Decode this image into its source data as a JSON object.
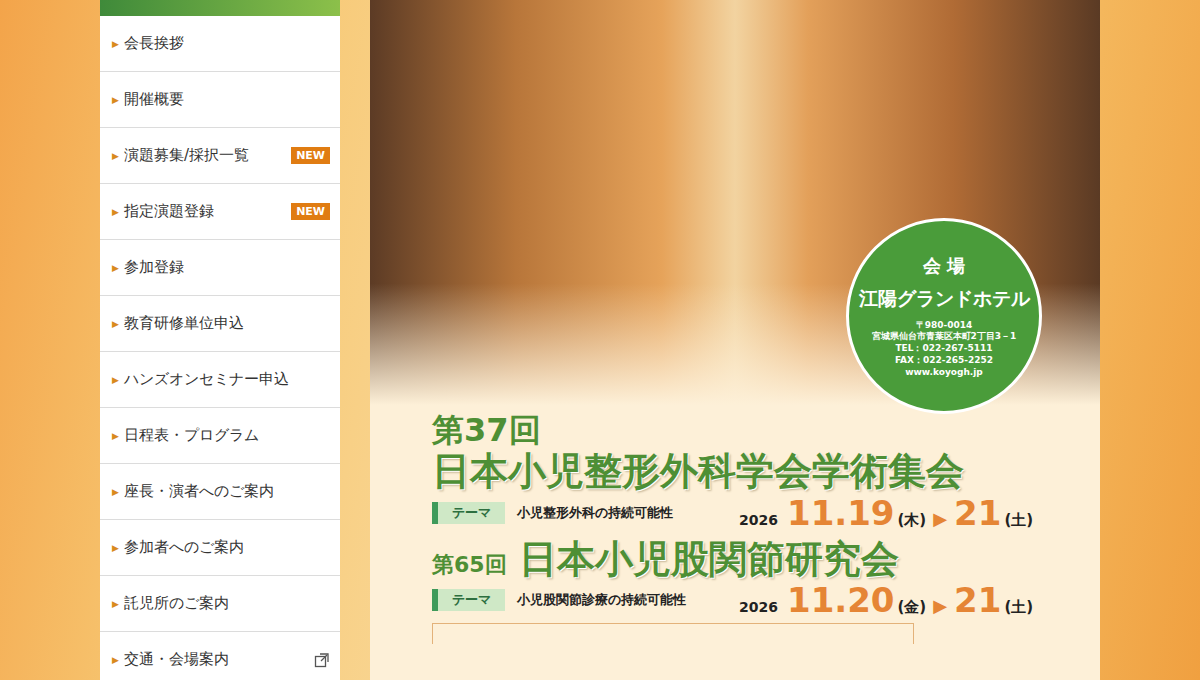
{
  "sidebar": {
    "bullet": "▶",
    "items": [
      {
        "label": "会長挨拶",
        "badge": "",
        "external": false
      },
      {
        "label": "開催概要",
        "badge": "",
        "external": false
      },
      {
        "label": "演題募集/採択一覧",
        "badge": "NEW",
        "external": false
      },
      {
        "label": "指定演題登録",
        "badge": "NEW",
        "external": false
      },
      {
        "label": "参加登録",
        "badge": "",
        "external": false
      },
      {
        "label": "教育研修単位申込",
        "badge": "",
        "external": false
      },
      {
        "label": "ハンズオンセミナー申込",
        "badge": "",
        "external": false
      },
      {
        "label": "日程表・プログラム",
        "badge": "",
        "external": false
      },
      {
        "label": "座長・演者へのご案内",
        "badge": "",
        "external": false
      },
      {
        "label": "参加者へのご案内",
        "badge": "",
        "external": false
      },
      {
        "label": "託児所のご案内",
        "badge": "",
        "external": false
      },
      {
        "label": "交通・会場案内",
        "badge": "",
        "external": true
      }
    ]
  },
  "venue": {
    "title": "会 場",
    "name": "江陽グランドホテル",
    "postal": "〒980-0014",
    "address": "宮城県仙台市青葉区本町2丁目3－1",
    "tel": "TEL：022-267-5111",
    "fax": "FAX：022-265-2252",
    "url": "www.koyogh.jp"
  },
  "meetings": [
    {
      "kind": "stacked",
      "ordinal": "第37回",
      "name": "日本小児整形外科学会学術集会",
      "theme_label": "テーマ",
      "theme": "小児整形外科の持続可能性",
      "year": "2026",
      "start": "11.19",
      "start_day": "(木)",
      "arrow": "▶",
      "end": "21",
      "end_day": "(土)"
    },
    {
      "kind": "inline",
      "ordinal": "第65回",
      "name": "日本小児股関節研究会",
      "theme_label": "テーマ",
      "theme": "小児股関節診療の持続可能性",
      "year": "2026",
      "start": "11.20",
      "start_day": "(金)",
      "arrow": "▶",
      "end": "21",
      "end_day": "(土)"
    }
  ]
}
